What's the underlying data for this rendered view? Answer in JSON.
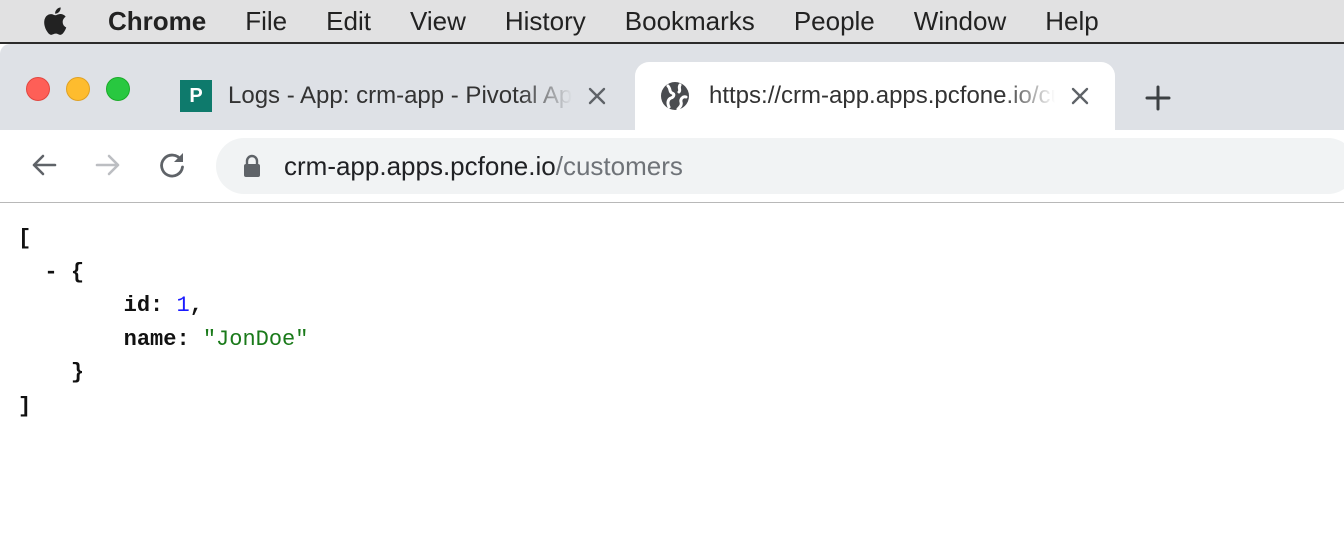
{
  "menubar": {
    "apple_icon": "apple-logo-icon",
    "items": [
      "Chrome",
      "File",
      "Edit",
      "View",
      "History",
      "Bookmarks",
      "People",
      "Window",
      "Help"
    ]
  },
  "window_controls": {
    "close_color": "#fe5f57",
    "minimize_color": "#febc2e",
    "zoom_color": "#28c840"
  },
  "tabs": [
    {
      "favicon": "P",
      "favicon_color": "#0e7a6c",
      "title": "Logs - App: crm-app - Pivotal Apps Manager",
      "active": false
    },
    {
      "favicon": "globe-icon",
      "title": "https://crm-app.apps.pcfone.io/customers",
      "active": true
    }
  ],
  "toolbar": {
    "omnibox": {
      "host": "crm-app.apps.pcfone.io",
      "path": "/customers"
    }
  },
  "json_view": {
    "open_bracket": "[",
    "collapse_toggle": "-",
    "open_brace": "{",
    "fields": [
      {
        "key": "id",
        "value": "1",
        "type": "number",
        "trailing": ","
      },
      {
        "key": "name",
        "value": "\"JonDoe\"",
        "type": "string",
        "trailing": ""
      }
    ],
    "close_brace": "}",
    "close_bracket": "]",
    "colors": {
      "number": "#1a1aff",
      "string": "#1a7a1a"
    }
  }
}
